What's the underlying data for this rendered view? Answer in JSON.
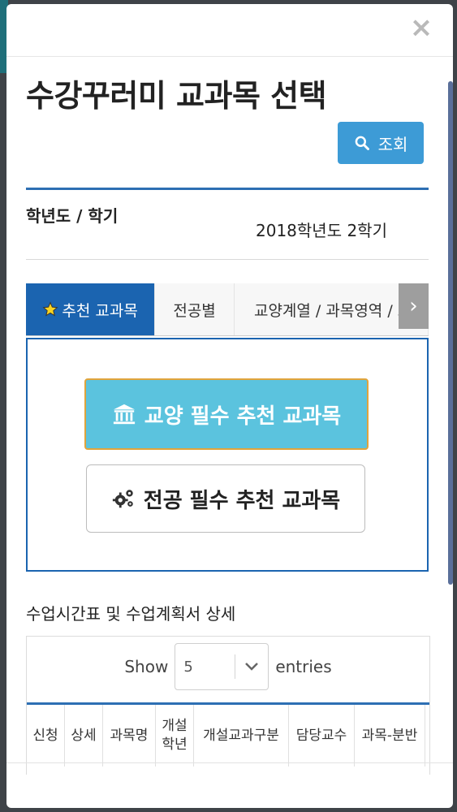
{
  "modal": {
    "title": "수강꾸러미 교과목 선택",
    "close_label": "×",
    "search_button": "조회"
  },
  "term": {
    "label": "학년도 / 학기",
    "value": "2018학년도 2학기"
  },
  "tabs": [
    {
      "label": "추천 교과목",
      "active": true
    },
    {
      "label": "전공별",
      "active": false
    },
    {
      "label": "교양계열 / 과목영역 / 교",
      "active": false
    }
  ],
  "tab_next_label": "›",
  "recommend": {
    "culture_button": "교양 필수 추천 교과목",
    "major_button": "전공 필수 추천 교과목"
  },
  "section": {
    "title": "수업시간표 및 수업계획서 상세"
  },
  "entries": {
    "show_label": "Show",
    "selected": "5",
    "entries_label": "entries"
  },
  "table": {
    "columns": [
      "신청",
      "상세",
      "과목명",
      "개설\n학년",
      "개설교과구분",
      "담당교수",
      "과목-분반"
    ]
  },
  "colors": {
    "primary": "#1b64b0",
    "search_button": "#3d9bd6",
    "culture_button": "#5bc3de",
    "culture_border": "#e0a43c"
  }
}
